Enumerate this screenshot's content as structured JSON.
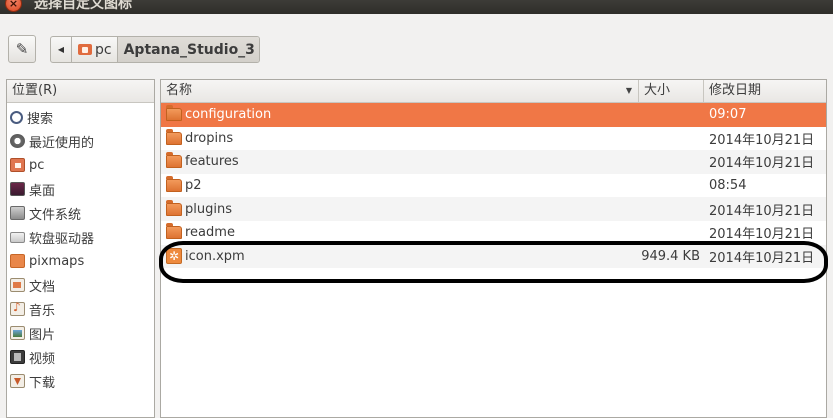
{
  "window": {
    "title": "选择自定义图标"
  },
  "pathbar": {
    "segments": [
      "pc",
      "Aptana_Studio_3"
    ]
  },
  "sidebar": {
    "header": "位置(R)",
    "items": [
      {
        "label": "搜索",
        "icon": "search-icon"
      },
      {
        "label": "最近使用的",
        "icon": "recent-icon"
      },
      {
        "label": "pc",
        "icon": "home-folder-icon"
      },
      {
        "label": "桌面",
        "icon": "desktop-icon"
      },
      {
        "label": "文件系统",
        "icon": "filesystem-icon"
      },
      {
        "label": "软盘驱动器",
        "icon": "floppy-drive-icon"
      },
      {
        "label": "pixmaps",
        "icon": "folder-icon"
      },
      {
        "label": "文档",
        "icon": "documents-icon"
      },
      {
        "label": "音乐",
        "icon": "music-icon"
      },
      {
        "label": "图片",
        "icon": "pictures-icon"
      },
      {
        "label": "视频",
        "icon": "videos-icon"
      },
      {
        "label": "下载",
        "icon": "downloads-icon"
      }
    ]
  },
  "file_list": {
    "columns": {
      "name": "名称",
      "size": "大小",
      "modified": "修改日期"
    },
    "rows": [
      {
        "name": "configuration",
        "size": "",
        "modified": "09:07",
        "type": "folder",
        "selected": true
      },
      {
        "name": "dropins",
        "size": "",
        "modified": "2014年10月21日",
        "type": "folder"
      },
      {
        "name": "features",
        "size": "",
        "modified": "2014年10月21日",
        "type": "folder"
      },
      {
        "name": "p2",
        "size": "",
        "modified": "08:54",
        "type": "folder"
      },
      {
        "name": "plugins",
        "size": "",
        "modified": "2014年10月21日",
        "type": "folder"
      },
      {
        "name": "readme",
        "size": "",
        "modified": "2014年10月21日",
        "type": "folder"
      },
      {
        "name": "icon.xpm",
        "size": "949.4 KB",
        "modified": "2014年10月21日",
        "type": "file"
      }
    ]
  },
  "colors": {
    "selection": "#f07746",
    "annotation_ring": "#000000"
  }
}
